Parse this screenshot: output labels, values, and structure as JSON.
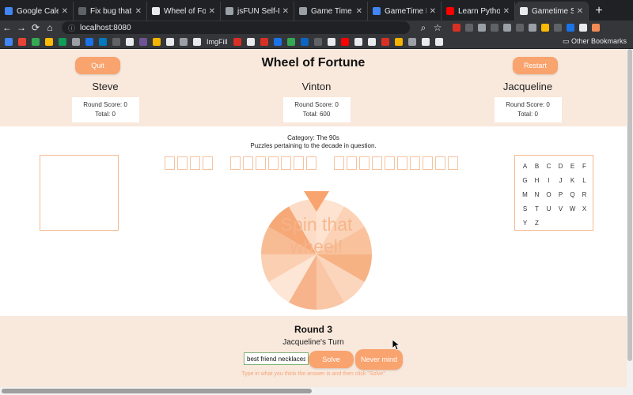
{
  "browser": {
    "tabs": [
      {
        "label": "Google Calendar",
        "color": "#4285f4",
        "active": false
      },
      {
        "label": "Fix bug that upda",
        "color": "#5f6368",
        "active": false
      },
      {
        "label": "Wheel of Fortune",
        "color": "#e8eaed",
        "active": false
      },
      {
        "label": "jsFUN Self-Directe",
        "color": "#9aa0a6",
        "active": false
      },
      {
        "label": "Game Time - Fron",
        "color": "#9aa0a6",
        "active": false
      },
      {
        "label": "GameTime Presen",
        "color": "#4285f4",
        "active": false
      },
      {
        "label": "Learn Python - Fu",
        "color": "#ff0000",
        "active": false
      },
      {
        "label": "Gametime Starter",
        "color": "#e8eaed",
        "active": true
      }
    ],
    "url": "localhost:8080",
    "bookmarks_label": "ImgFill",
    "other_bookmarks": "Other Bookmarks"
  },
  "game": {
    "title": "Wheel of Fortune",
    "quit_label": "Quit",
    "restart_label": "Restart",
    "score_label": "Round Score: ",
    "total_label": "Total: ",
    "players": [
      {
        "name": "Steve",
        "round": "Round Score: 0",
        "total": "Total: 0"
      },
      {
        "name": "Vinton",
        "round": "Round Score: 0",
        "total": "Total: 600"
      },
      {
        "name": "Jacqueline",
        "round": "Round Score: 0",
        "total": "Total: 0"
      }
    ],
    "category": "Category: The 90s",
    "description": "Puzzles pertaining to the decade in question.",
    "puzzle_words": [
      4,
      7,
      10
    ],
    "alphabet": [
      "A",
      "B",
      "C",
      "D",
      "E",
      "F",
      "G",
      "H",
      "I",
      "J",
      "K",
      "L",
      "M",
      "N",
      "O",
      "P",
      "Q",
      "R",
      "S",
      "T",
      "U",
      "V",
      "W",
      "X",
      "Y",
      "Z"
    ],
    "spin_text": "Spin that wheel!",
    "round": "Round 3",
    "turn": "Jacqueline's Turn",
    "answer_value": "best friend necklaces",
    "solve_label": "Solve",
    "never_mind_label": "Never mind",
    "hint": "Type in what you think the answer is and then click \"Solve\"",
    "colors": {
      "accent": "#f9a36e",
      "panel": "#f9e8dc"
    }
  }
}
